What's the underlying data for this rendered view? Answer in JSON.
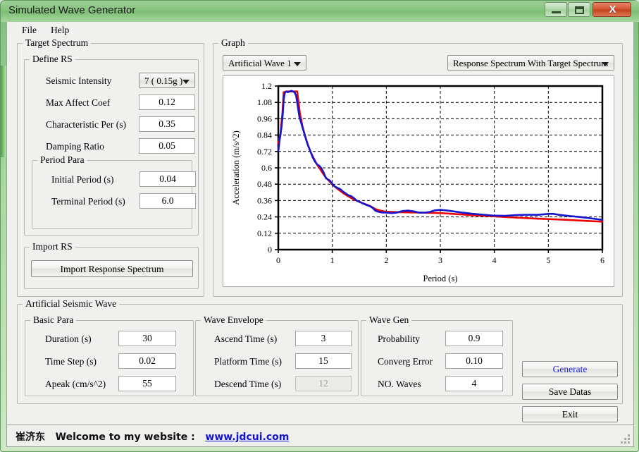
{
  "window": {
    "title": "Simulated Wave Generator",
    "minimize_label": "—",
    "maximize_label": "□",
    "close_label": "X"
  },
  "menu": {
    "items": [
      {
        "label": "File"
      },
      {
        "label": "Help"
      }
    ]
  },
  "target_spectrum": {
    "title": "Target Spectrum",
    "define_rs": {
      "title": "Define RS",
      "seismic_intensity": {
        "label": "Seismic Intensity",
        "value": "7 ( 0.15g )"
      },
      "fields": [
        {
          "label": "Max Affect Coef",
          "value": "0.12"
        },
        {
          "label": "Characteristic Per (s)",
          "value": "0.35"
        },
        {
          "label": "Damping Ratio",
          "value": "0.05"
        }
      ],
      "period_para": {
        "title": "Period Para",
        "fields": [
          {
            "label": "Initial Period (s)",
            "value": "0.04"
          },
          {
            "label": "Terminal Period (s)",
            "value": "6.0"
          }
        ]
      }
    },
    "import_rs": {
      "title": "Import RS",
      "button_label": "Import Response Spectrum"
    }
  },
  "graph": {
    "title": "Graph",
    "wave_select": {
      "value": "Artificial Wave 1"
    },
    "view_select": {
      "value": "Response Spectrum With Target Spectrum"
    }
  },
  "artificial_seismic_wave": {
    "title": "Artificial Seismic Wave",
    "basic_para": {
      "title": "Basic Para",
      "fields": [
        {
          "label": "Duration (s)",
          "value": "30",
          "disabled": false
        },
        {
          "label": "Time Step (s)",
          "value": "0.02",
          "disabled": false
        },
        {
          "label": "Apeak (cm/s^2)",
          "value": "55",
          "disabled": false
        }
      ]
    },
    "wave_envelope": {
      "title": "Wave Envelope",
      "fields": [
        {
          "label": "Ascend Time (s)",
          "value": "3",
          "disabled": false
        },
        {
          "label": "Platform Time (s)",
          "value": "15",
          "disabled": false
        },
        {
          "label": "Descend Time (s)",
          "value": "12",
          "disabled": true
        }
      ]
    },
    "wave_gen": {
      "title": "Wave Gen",
      "fields": [
        {
          "label": "Probability",
          "value": "0.9",
          "disabled": false
        },
        {
          "label": "Converg Error",
          "value": "0.10",
          "disabled": false
        },
        {
          "label": "NO. Waves",
          "value": "4",
          "disabled": false
        }
      ]
    },
    "actions": [
      {
        "label": "Generate",
        "accent": true
      },
      {
        "label": "Save Datas",
        "accent": false
      },
      {
        "label": "Exit",
        "accent": false
      }
    ]
  },
  "statusbar": {
    "author": "崔济东",
    "message": "Welcome to my website :",
    "link": "www.jdcui.com"
  },
  "chart_data": {
    "type": "line",
    "title": "",
    "xlabel": "Period (s)",
    "ylabel": "Acceleration (m/s^2)",
    "xlim": [
      0,
      6
    ],
    "ylim": [
      0,
      1.2
    ],
    "xticks": [
      0,
      1,
      2,
      3,
      4,
      5,
      6
    ],
    "yticks": [
      0,
      0.12,
      0.24,
      0.36,
      0.48,
      0.6,
      0.72,
      0.84,
      0.96,
      1.08,
      1.2
    ],
    "ytick_labels": [
      "0",
      "0.12",
      "0.24",
      "0.36",
      "0.48",
      "0.6",
      "0.72",
      "0.84",
      "0.96",
      "1.08",
      "1.2"
    ],
    "xtick_labels": [
      "0",
      "1",
      "2",
      "3",
      "4",
      "5",
      "6"
    ],
    "grid": true,
    "grid_style": "dashed",
    "legend": "none",
    "colors": {
      "target": "#ee0000",
      "response": "#1515cc"
    },
    "series": [
      {
        "name": "Target Spectrum",
        "color": "#ee0000",
        "x": [
          0.0,
          0.04,
          0.08,
          0.1,
          0.15,
          0.2,
          0.25,
          0.3,
          0.35,
          0.4,
          0.45,
          0.5,
          0.55,
          0.6,
          0.65,
          0.7,
          0.75,
          0.8,
          0.85,
          0.9,
          0.95,
          1.0,
          1.1,
          1.2,
          1.3,
          1.4,
          1.5,
          1.6,
          1.7,
          1.8,
          1.9,
          2.0,
          2.2,
          2.4,
          2.6,
          2.8,
          3.0,
          3.2,
          3.4,
          3.6,
          3.8,
          4.0,
          4.25,
          4.5,
          4.75,
          5.0,
          5.25,
          5.5,
          5.75,
          6.0
        ],
        "y": [
          0.78,
          0.84,
          1.02,
          1.155,
          1.16,
          1.16,
          1.16,
          1.16,
          1.16,
          1.0,
          0.9,
          0.83,
          0.765,
          0.715,
          0.675,
          0.635,
          0.605,
          0.575,
          0.545,
          0.52,
          0.5,
          0.478,
          0.445,
          0.415,
          0.39,
          0.368,
          0.35,
          0.335,
          0.32,
          0.297,
          0.285,
          0.278,
          0.275,
          0.273,
          0.272,
          0.27,
          0.268,
          0.263,
          0.258,
          0.252,
          0.248,
          0.244,
          0.238,
          0.233,
          0.228,
          0.224,
          0.22,
          0.215,
          0.21,
          0.205
        ]
      },
      {
        "name": "Response Spectrum",
        "color": "#1515cc",
        "x": [
          0.0,
          0.02,
          0.04,
          0.06,
          0.08,
          0.1,
          0.12,
          0.15,
          0.18,
          0.21,
          0.24,
          0.27,
          0.3,
          0.33,
          0.36,
          0.39,
          0.42,
          0.45,
          0.48,
          0.52,
          0.56,
          0.6,
          0.64,
          0.68,
          0.72,
          0.76,
          0.8,
          0.84,
          0.88,
          0.92,
          0.96,
          1.0,
          1.05,
          1.1,
          1.15,
          1.2,
          1.25,
          1.3,
          1.35,
          1.4,
          1.45,
          1.5,
          1.55,
          1.6,
          1.65,
          1.7,
          1.75,
          1.8,
          1.85,
          1.9,
          1.95,
          2.0,
          2.1,
          2.2,
          2.3,
          2.4,
          2.5,
          2.6,
          2.7,
          2.8,
          2.9,
          3.0,
          3.1,
          3.2,
          3.4,
          3.6,
          3.8,
          4.0,
          4.2,
          4.4,
          4.6,
          4.8,
          5.0,
          5.1,
          5.2,
          5.4,
          5.6,
          5.8,
          6.0
        ],
        "y": [
          0.72,
          0.79,
          0.845,
          0.9,
          0.98,
          1.1,
          1.15,
          1.16,
          1.155,
          1.16,
          1.165,
          1.16,
          1.155,
          1.13,
          1.055,
          0.975,
          0.935,
          0.895,
          0.855,
          0.8,
          0.755,
          0.715,
          0.675,
          0.645,
          0.625,
          0.615,
          0.595,
          0.565,
          0.525,
          0.515,
          0.505,
          0.482,
          0.462,
          0.452,
          0.443,
          0.425,
          0.412,
          0.398,
          0.392,
          0.378,
          0.36,
          0.352,
          0.342,
          0.333,
          0.325,
          0.318,
          0.305,
          0.285,
          0.278,
          0.274,
          0.272,
          0.272,
          0.268,
          0.272,
          0.283,
          0.286,
          0.281,
          0.272,
          0.271,
          0.276,
          0.288,
          0.292,
          0.288,
          0.283,
          0.272,
          0.263,
          0.256,
          0.249,
          0.248,
          0.253,
          0.256,
          0.255,
          0.262,
          0.262,
          0.255,
          0.246,
          0.239,
          0.229,
          0.218
        ]
      }
    ]
  }
}
